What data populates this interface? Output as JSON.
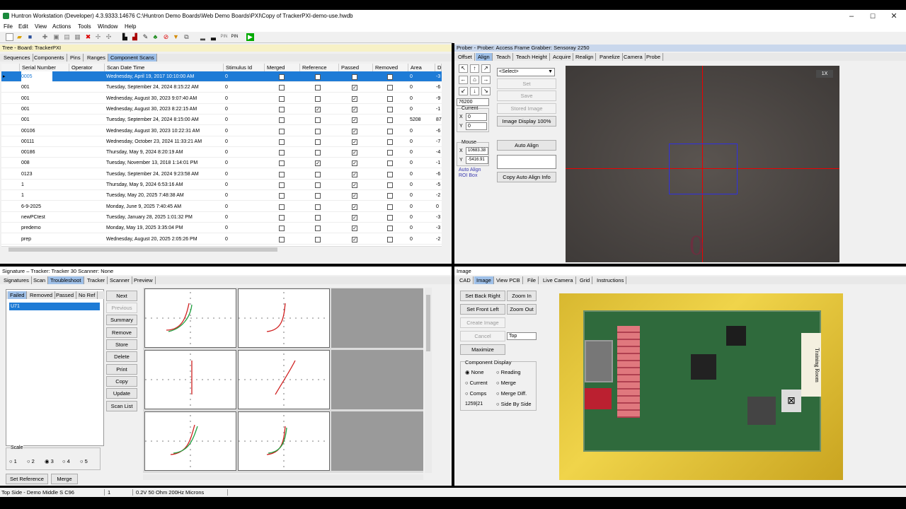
{
  "window": {
    "title": "Huntron Workstation (Developer) 4.3.9333.14676  C:\\Huntron Demo Boards\\Web Demo Boards\\PXI\\Copy of TrackerPXI-demo-use.hwdb",
    "min": "–",
    "max": "☐",
    "close": "✕"
  },
  "menu": [
    "File",
    "Edit",
    "View",
    "Actions",
    "Tools",
    "Window",
    "Help"
  ],
  "tree": {
    "title": "Tree - Board: TrackerPXI",
    "tabs": [
      "Sequences",
      "Components",
      "Pins",
      "Ranges",
      "Component Scans"
    ],
    "columns": [
      "Serial Number",
      "Operator",
      "Scan Date Time",
      "Stimulus Id",
      "Merged",
      "Reference",
      "Passed",
      "Removed",
      "Area",
      "D"
    ],
    "rows": [
      {
        "serial": "0005",
        "op": "",
        "date": "Wednesday, April 19, 2017 10:10:00 AM",
        "stim": "0",
        "merged": false,
        "ref": true,
        "passed": true,
        "removed": false,
        "area": "0",
        "d": "-3"
      },
      {
        "serial": "001",
        "op": "",
        "date": "Tuesday, September 24, 2024 8:15:22 AM",
        "stim": "0",
        "merged": false,
        "ref": false,
        "passed": true,
        "removed": false,
        "area": "0",
        "d": "-6"
      },
      {
        "serial": "001",
        "op": "",
        "date": "Wednesday, August 30, 2023 9:07:40 AM",
        "stim": "0",
        "merged": false,
        "ref": false,
        "passed": true,
        "removed": false,
        "area": "0",
        "d": "-9"
      },
      {
        "serial": "001",
        "op": "",
        "date": "Wednesday, August 30, 2023 8:22:15 AM",
        "stim": "0",
        "merged": false,
        "ref": true,
        "passed": true,
        "removed": false,
        "area": "0",
        "d": "-1"
      },
      {
        "serial": "001",
        "op": "",
        "date": "Tuesday, September 24, 2024 8:15:00 AM",
        "stim": "0",
        "merged": false,
        "ref": false,
        "passed": true,
        "removed": false,
        "area": "5208",
        "d": "87"
      },
      {
        "serial": "00106",
        "op": "",
        "date": "Wednesday, August 30, 2023 10:22:31 AM",
        "stim": "0",
        "merged": false,
        "ref": false,
        "passed": true,
        "removed": false,
        "area": "0",
        "d": "-6"
      },
      {
        "serial": "00111",
        "op": "",
        "date": "Wednesday, October 23, 2024 11:33:21 AM",
        "stim": "0",
        "merged": false,
        "ref": false,
        "passed": true,
        "removed": false,
        "area": "0",
        "d": "-7"
      },
      {
        "serial": "00186",
        "op": "",
        "date": "Thursday, May 9, 2024 8:20:19 AM",
        "stim": "0",
        "merged": false,
        "ref": false,
        "passed": true,
        "removed": false,
        "area": "0",
        "d": "-4"
      },
      {
        "serial": "008",
        "op": "",
        "date": "Tuesday, November 13, 2018 1:14:01 PM",
        "stim": "0",
        "merged": false,
        "ref": true,
        "passed": true,
        "removed": false,
        "area": "0",
        "d": "-1"
      },
      {
        "serial": "0123",
        "op": "",
        "date": "Tuesday, September 24, 2024 9:23:58 AM",
        "stim": "0",
        "merged": false,
        "ref": false,
        "passed": true,
        "removed": false,
        "area": "0",
        "d": "-6"
      },
      {
        "serial": "1",
        "op": "",
        "date": "Thursday, May 9, 2024 6:53:16 AM",
        "stim": "0",
        "merged": false,
        "ref": false,
        "passed": true,
        "removed": false,
        "area": "0",
        "d": "-5"
      },
      {
        "serial": "1",
        "op": "",
        "date": "Tuesday, May 20, 2025 7:48:38 AM",
        "stim": "0",
        "merged": false,
        "ref": false,
        "passed": true,
        "removed": false,
        "area": "0",
        "d": "-2"
      },
      {
        "serial": "6-9-2025",
        "op": "",
        "date": "Monday, June 9, 2025 7:40:45 AM",
        "stim": "0",
        "merged": false,
        "ref": false,
        "passed": true,
        "removed": false,
        "area": "0",
        "d": "0"
      },
      {
        "serial": "newPCtest",
        "op": "",
        "date": "Tuesday, January 28, 2025 1:01:32 PM",
        "stim": "0",
        "merged": false,
        "ref": false,
        "passed": true,
        "removed": false,
        "area": "0",
        "d": "-3"
      },
      {
        "serial": "predemo",
        "op": "",
        "date": "Monday, May 19, 2025 3:35:04 PM",
        "stim": "0",
        "merged": false,
        "ref": false,
        "passed": true,
        "removed": false,
        "area": "0",
        "d": "-3"
      },
      {
        "serial": "prep",
        "op": "",
        "date": "Wednesday, August 20, 2025 2:05:26 PM",
        "stim": "0",
        "merged": false,
        "ref": false,
        "passed": true,
        "removed": false,
        "area": "0",
        "d": "-2"
      }
    ]
  },
  "prober": {
    "title": "Prober - Prober: Access Frame Grabber: Sensoray 2250",
    "tabs": [
      "Offset",
      "Align",
      "Teach",
      "Teach Height",
      "Acquire",
      "Realign",
      "Panelize",
      "Camera",
      "Probe"
    ],
    "select": "<Select>",
    "step": "76200",
    "set": "Set",
    "save": "Save",
    "stored": "Stored Image",
    "display": "Image Display 100%",
    "current_label": "Current",
    "cx": "0",
    "cy": "0",
    "mouse_label": "Mouse",
    "mx": "10683.38",
    "my": "-5416.91",
    "x": "X",
    "y": "Y",
    "auto_align": "Auto Align",
    "auto_roi": "Auto Align\nROI Box",
    "copy_info": "Copy Auto Align Info",
    "zoom": "1X"
  },
  "signature": {
    "title": "Signature – Tracker: Tracker 30  Scanner: None",
    "tabs": [
      "Signatures",
      "Scan",
      "Troubleshoot",
      "Tracker",
      "Scanner",
      "Preview"
    ],
    "filters": [
      "Failed",
      "Removed",
      "Passed",
      "No Ref"
    ],
    "list": [
      "U71"
    ],
    "buttons": [
      "Next",
      "Previous",
      "Summary",
      "Remove",
      "Store",
      "Delete",
      "Print",
      "Copy",
      "Update",
      "Scan List"
    ],
    "scale_label": "Scale",
    "scales": [
      "1",
      "2",
      "3",
      "4",
      "5"
    ],
    "set_ref": "Set Reference",
    "merge": "Merge"
  },
  "image": {
    "title": "Image",
    "tabs": [
      "CAD",
      "Image",
      "View PCB",
      "File",
      "Live Camera",
      "Grid",
      "Instructions"
    ],
    "buttons": [
      "Set Back Right",
      "Zoom In",
      "Set Front Left",
      "Zoom Out",
      "Create Image",
      "Cancel",
      "Maximize"
    ],
    "side": "Top",
    "group": "Component Display",
    "radios": [
      "None",
      "Reading",
      "Current",
      "Merge",
      "Comps",
      "Merge Diff.",
      "Side By Side"
    ],
    "count": "1259|21",
    "board_text": "Training Room"
  },
  "status": [
    "Top Side - Demo Middle S C96",
    "1",
    "0.2V 50 Ohm 200Hz Microns"
  ]
}
